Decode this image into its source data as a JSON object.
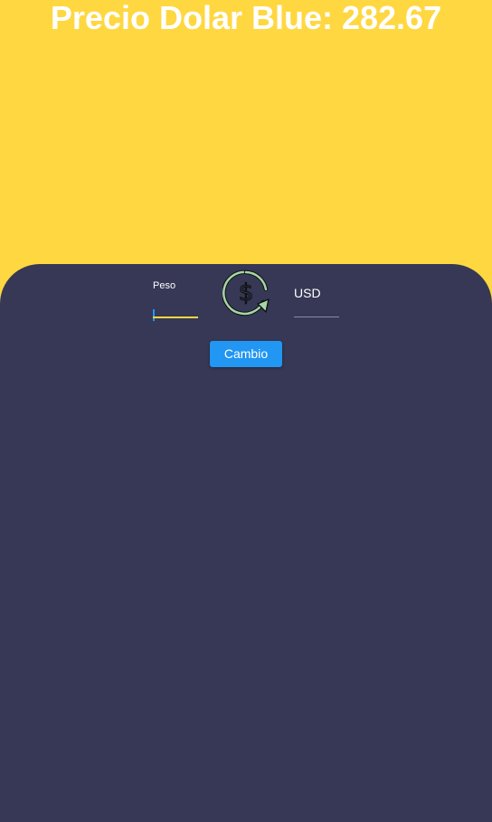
{
  "header": {
    "title": "Precio Dolar Blue: 282.67"
  },
  "converter": {
    "peso_label": "Peso",
    "peso_value": "",
    "usd_label": "USD",
    "usd_value": "",
    "exchange_icon": "dollar-exchange-icon",
    "button_label": "Cambio"
  },
  "colors": {
    "background": "#FFD740",
    "panel": "#363856",
    "accent": "#2196F3",
    "active_underline": "#FFD740",
    "icon_ring": "#A5D6A7"
  }
}
